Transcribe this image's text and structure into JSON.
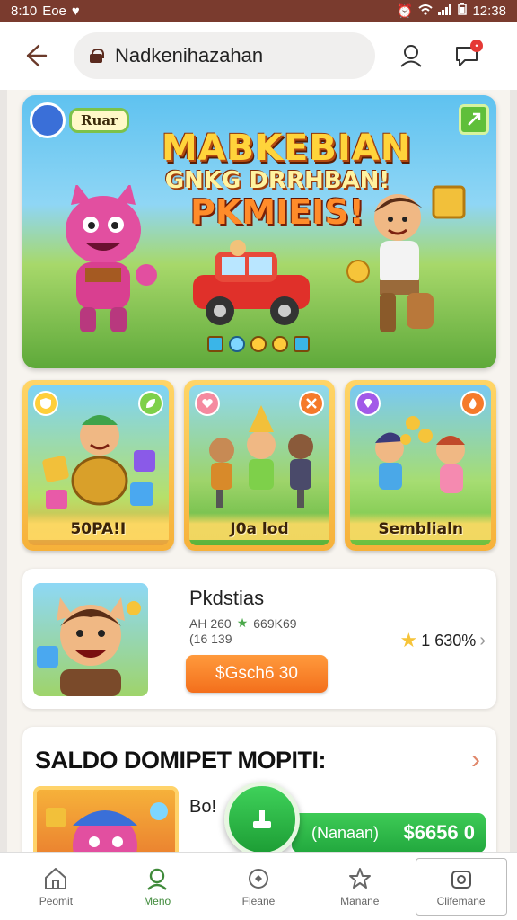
{
  "status": {
    "time_left": "8:10",
    "carrier": "Eoe",
    "time_right": "12:38"
  },
  "topbar": {
    "url": "Nadkenihazahan"
  },
  "hero": {
    "badge": "Ruar",
    "title_line1": "MABKEBIAN",
    "title_line2": "GNKG DRRHBAN!",
    "title_line3": "PKMIEIS!"
  },
  "categories": [
    {
      "label": "50PA!I"
    },
    {
      "label": "J0a lod"
    },
    {
      "label": "Semblialn"
    }
  ],
  "feature": {
    "title": "Pkdstias",
    "meta1": "AH 260",
    "meta1b": "669K69",
    "meta2": "(16 139",
    "button": "$Gsch6 30",
    "rating": "1 630%"
  },
  "wallet": {
    "title": "SALDO DOMIPET MOPITI:",
    "sub": "Bo!",
    "name": "(Nanaan)",
    "amount": "$6656 0"
  },
  "nav": [
    {
      "label": "Peomit"
    },
    {
      "label": "Meno"
    },
    {
      "label": "Fleane"
    },
    {
      "label": "Manane"
    },
    {
      "label": "Clifemane"
    }
  ],
  "colors": {
    "accent": "#f36f1c",
    "wallet_green": "#22a83e",
    "status_bar": "#7a3b2e"
  }
}
